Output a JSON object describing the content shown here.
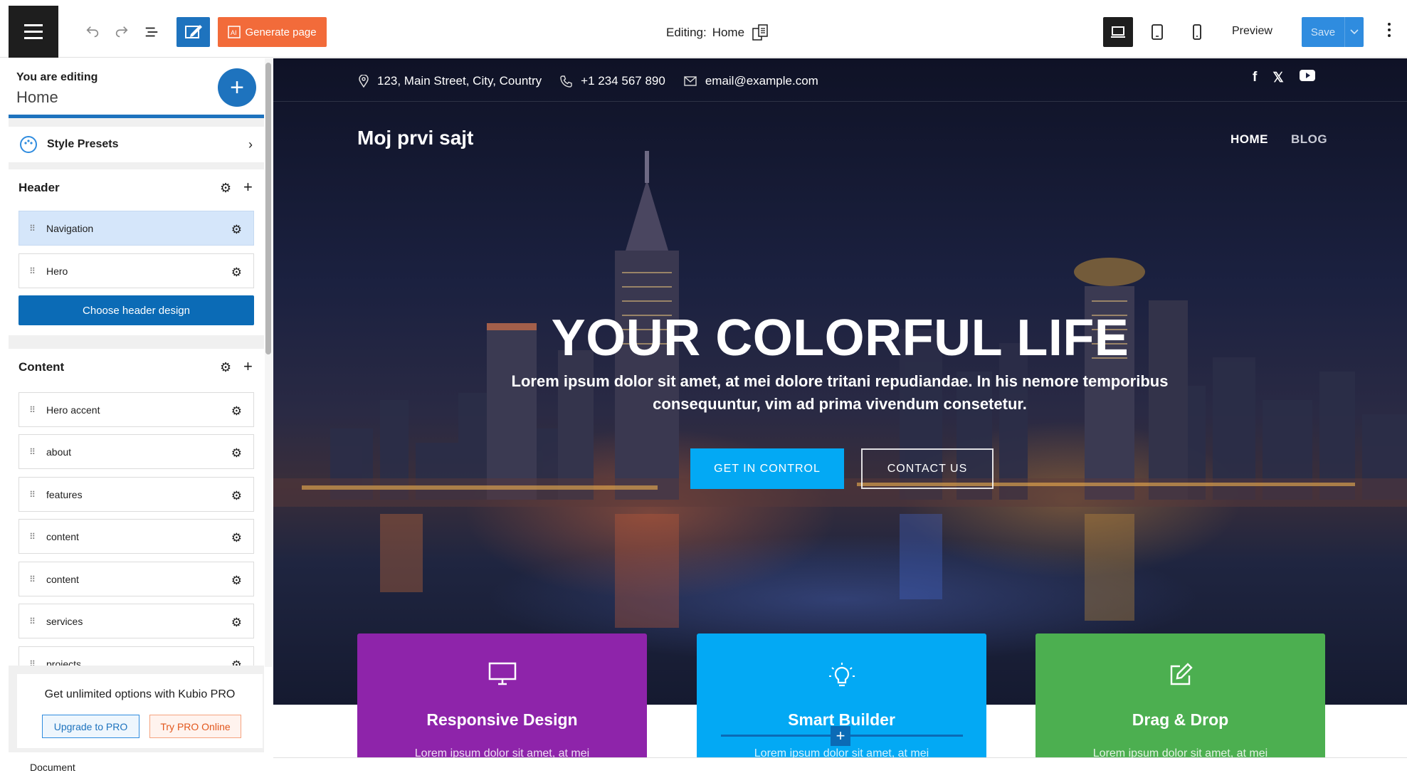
{
  "toolbar": {
    "generate_label": "Generate page",
    "editing_label": "Editing:",
    "editing_page": "Home",
    "preview_label": "Preview",
    "save_label": "Save"
  },
  "sidebar": {
    "editing_label": "You are editing",
    "page_name": "Home",
    "style_presets": "Style Presets",
    "header_section": {
      "title": "Header",
      "items": [
        {
          "label": "Navigation"
        },
        {
          "label": "Hero"
        }
      ],
      "choose_label": "Choose header design"
    },
    "content_section": {
      "title": "Content",
      "items": [
        {
          "label": "Hero accent"
        },
        {
          "label": "about"
        },
        {
          "label": "features"
        },
        {
          "label": "content"
        },
        {
          "label": "content"
        },
        {
          "label": "services"
        },
        {
          "label": "projects"
        }
      ]
    },
    "promo": {
      "text": "Get unlimited options with Kubio PRO",
      "upgrade_label": "Upgrade to PRO",
      "try_label": "Try PRO Online"
    },
    "document_label": "Document"
  },
  "site": {
    "address": "123, Main Street, City, Country",
    "phone": "+1 234 567 890",
    "email": "email@example.com",
    "logo": "Moj prvi sajt",
    "nav": {
      "home": "HOME",
      "blog": "BLOG"
    },
    "hero_title": "YOUR COLORFUL LIFE",
    "hero_subtitle": "Lorem ipsum dolor sit amet, at mei dolore tritani repudiandae. In his nemore temporibus consequuntur, vim ad prima vivendum consetetur.",
    "cta_primary": "GET IN CONTROL",
    "cta_secondary": "CONTACT US",
    "cards": [
      {
        "title": "Responsive Design",
        "body": "Lorem ipsum dolor sit amet, at mei",
        "color": "#8e24aa",
        "icon": "monitor-icon"
      },
      {
        "title": "Smart Builder",
        "body": "Lorem ipsum dolor sit amet, at mei",
        "color": "#03a9f4",
        "icon": "lightbulb-icon"
      },
      {
        "title": "Drag & Drop",
        "body": "Lorem ipsum dolor sit amet, at mei",
        "color": "#4caf50",
        "icon": "edit-icon"
      }
    ]
  },
  "colors": {
    "accent_blue": "#1e73be",
    "generate_orange": "#f26b3a",
    "cta_blue": "#03a9f4"
  }
}
